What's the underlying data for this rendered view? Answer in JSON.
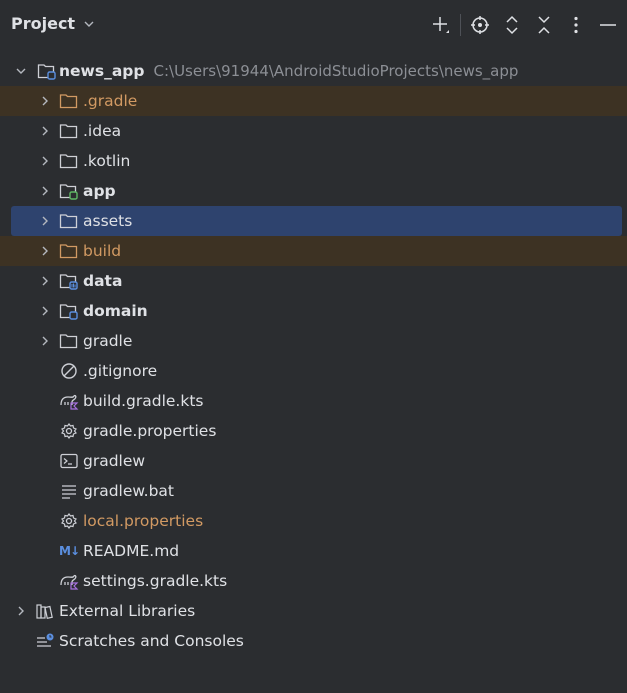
{
  "header": {
    "title": "Project",
    "toolbar": [
      "add-icon",
      "locate-icon",
      "expand-all-icon",
      "collapse-all-icon",
      "more-icon",
      "hide-icon"
    ]
  },
  "tree": {
    "root": {
      "label": "news_app",
      "path": "C:\\Users\\91944\\AndroidStudioProjects\\news_app"
    },
    "items": [
      {
        "label": ".gradle",
        "type": "folder",
        "state": "excluded"
      },
      {
        "label": ".idea",
        "type": "folder"
      },
      {
        "label": ".kotlin",
        "type": "folder"
      },
      {
        "label": "app",
        "type": "module"
      },
      {
        "label": "assets",
        "type": "folder",
        "state": "selected"
      },
      {
        "label": "build",
        "type": "folder",
        "state": "excluded"
      },
      {
        "label": "data",
        "type": "module"
      },
      {
        "label": "domain",
        "type": "module"
      },
      {
        "label": "gradle",
        "type": "folder"
      },
      {
        "label": ".gitignore",
        "type": "file"
      },
      {
        "label": "build.gradle.kts",
        "type": "file"
      },
      {
        "label": "gradle.properties",
        "type": "file"
      },
      {
        "label": "gradlew",
        "type": "file"
      },
      {
        "label": "gradlew.bat",
        "type": "file"
      },
      {
        "label": "local.properties",
        "type": "file"
      },
      {
        "label": "README.md",
        "type": "file",
        "icon_text": "M↓"
      },
      {
        "label": "settings.gradle.kts",
        "type": "file"
      }
    ],
    "external_libraries": "External Libraries",
    "scratches": "Scratches and Consoles"
  },
  "colors": {
    "background": "#2b2d30",
    "selected_row": "#2e436e",
    "excluded_row": "#3d3223",
    "excluded_text": "#d29a63",
    "path_text": "#8c8f95",
    "module_badge": "#5b8fe0",
    "app_badge": "#5fb865",
    "gradle_badge": "#a772e0"
  }
}
